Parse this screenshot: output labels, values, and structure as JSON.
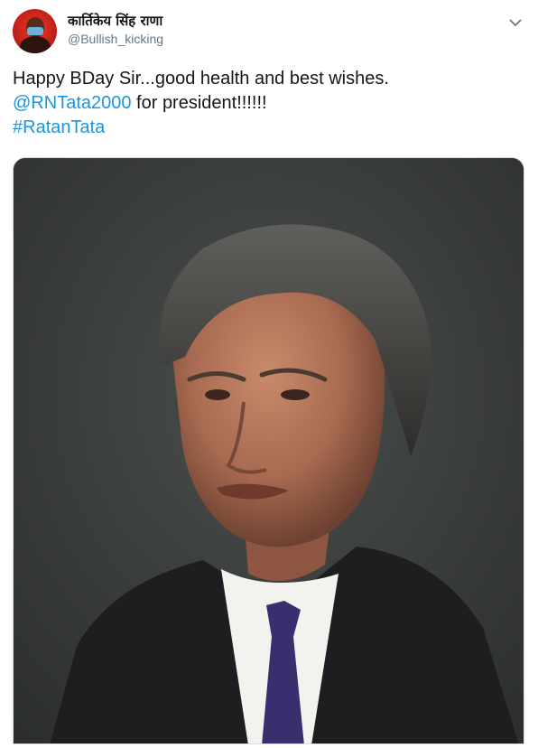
{
  "tweet": {
    "author": {
      "display_name": "कार्तिकेय सिंह राणा",
      "handle": "@Bullish_kicking"
    },
    "text": {
      "line1": "Happy BDay Sir...good health and best wishes.",
      "mention": "@RNTata2000",
      "line2_rest": " for president!!!!!!",
      "hashtag": "#RatanTata"
    },
    "icons": {
      "menu": "chevron-down-icon"
    },
    "colors": {
      "link": "#1b95e0",
      "handle": "#657786",
      "avatar_bg": "#d42a1c"
    }
  }
}
